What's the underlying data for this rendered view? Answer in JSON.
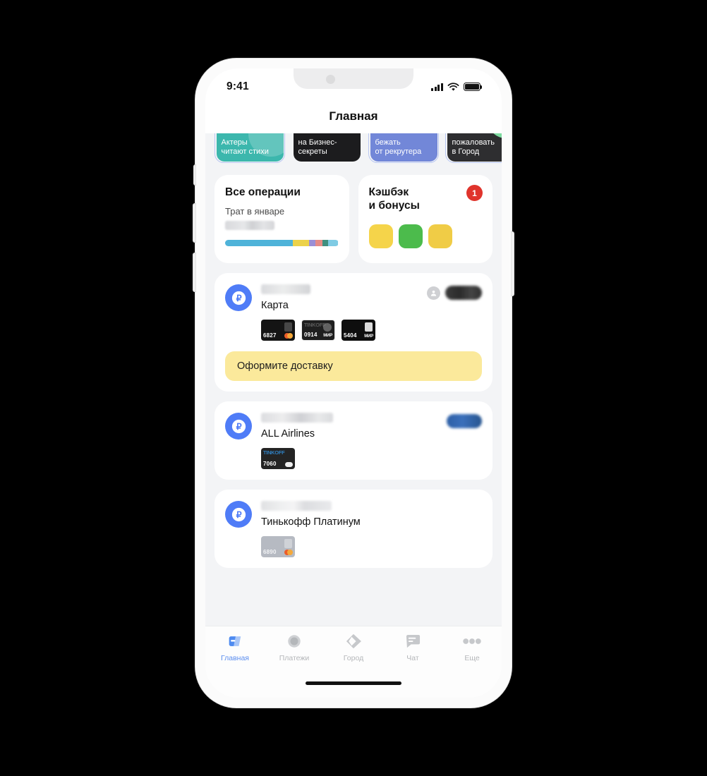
{
  "status_bar": {
    "time": "9:41",
    "signal_icon": "cellular-bars-icon",
    "wifi_icon": "wifi-icon",
    "battery_icon": "battery-full-icon"
  },
  "nav": {
    "title": "Главная"
  },
  "stories": [
    {
      "text": "Актеры\nчитают стихи",
      "bg": "#3cb7ad",
      "text_color": "#ffffff",
      "ring": true,
      "accent": "radial"
    },
    {
      "text": "на Бизнес-\nсекреты",
      "bg": "#1c1c1e",
      "text_color": "#ffffff",
      "ring": false,
      "accent": "none"
    },
    {
      "text": "бежать\nот рекрутера",
      "bg": "#7287d8",
      "text_color": "#ffffff",
      "ring": true,
      "accent": "none"
    },
    {
      "text": "пожаловать\nв Город",
      "bg": "#2e2e30",
      "text_color": "#ffffff",
      "ring": true,
      "accent": "green"
    }
  ],
  "mid_cards": {
    "operations": {
      "title": "Все операции",
      "subtitle": "Трат в январе",
      "amount_hidden": true,
      "segments": [
        {
          "color": "#4fb3d9",
          "pct": 60
        },
        {
          "color": "#ecd24a",
          "pct": 14
        },
        {
          "color": "#9b8fd6",
          "pct": 6
        },
        {
          "color": "#e58b86",
          "pct": 6
        },
        {
          "color": "#3f8f7f",
          "pct": 5
        },
        {
          "color": "#7fcbe4",
          "pct": 9
        }
      ]
    },
    "cashback": {
      "title": "Кэшбэк\nи бонусы",
      "badge": "1",
      "badge_color": "#e0342c",
      "tiles": [
        "#f5d44a",
        "#4cbb4c",
        "#f0cc46"
      ]
    }
  },
  "accounts": [
    {
      "icon": "ruble-circle-icon",
      "name": "Карта",
      "balance_hidden": true,
      "has_avatar": true,
      "pill_color": "#3a3a3a",
      "cards": [
        {
          "last4": "6827",
          "bg": "#141414",
          "network": "mastercard",
          "brand": ""
        },
        {
          "last4": "0914",
          "bg": "#1f1f1f",
          "network": "mir",
          "brand": "TINKOFF",
          "contactless": true,
          "outlined": true
        },
        {
          "last4": "5404",
          "bg": "#0e0e0e",
          "network": "mir",
          "brand": "",
          "person": true
        }
      ],
      "cta": "Оформите доставку"
    },
    {
      "icon": "ruble-circle-icon",
      "name": "ALL Airlines",
      "balance_hidden": true,
      "has_avatar": false,
      "pill_color": "#2c5fa8",
      "cards": [
        {
          "last4": "7060",
          "bg": "#242424",
          "network": "dots",
          "brand": "TINKOFF",
          "brand_color": "#2f7fc1"
        }
      ],
      "cta": ""
    },
    {
      "icon": "ruble-circle-icon",
      "name": "Тинькофф Платинум",
      "balance_hidden": true,
      "has_avatar": false,
      "pill_color": "#566275",
      "cards": [
        {
          "last4": "6890",
          "bg": "#b6bac2",
          "network": "mastercard",
          "brand": ""
        }
      ],
      "cta": ""
    }
  ],
  "tabs": [
    {
      "label": "Главная",
      "icon": "home-icon",
      "active": true
    },
    {
      "label": "Платежи",
      "icon": "payments-icon",
      "active": false
    },
    {
      "label": "Город",
      "icon": "city-icon",
      "active": false
    },
    {
      "label": "Чат",
      "icon": "chat-icon",
      "active": false
    },
    {
      "label": "Еще",
      "icon": "more-icon",
      "active": false
    }
  ],
  "colors": {
    "accent_blue": "#4f7cf7",
    "tab_active": "#5b8def",
    "screen_bg": "#f3f4f6",
    "cta_yellow": "#fbe99b"
  }
}
